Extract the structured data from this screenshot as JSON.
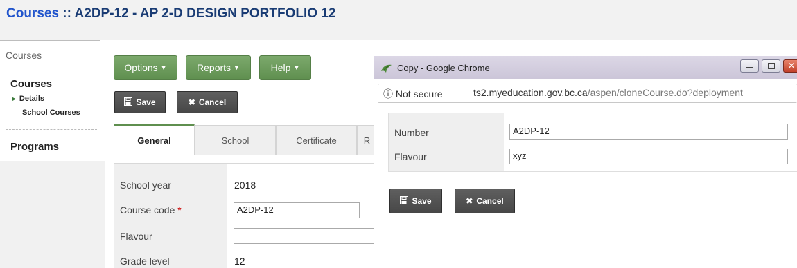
{
  "page": {
    "title_link": "Courses",
    "title_rest": " :: A2DP-12 - AP 2-D DESIGN PORTFOLIO 12"
  },
  "nav": {
    "header": "Courses",
    "section": "Courses",
    "items": [
      "Details",
      "School Courses"
    ],
    "programs": "Programs"
  },
  "menu": {
    "options": "Options",
    "reports": "Reports",
    "help": "Help"
  },
  "actions": {
    "save": "Save",
    "cancel": "Cancel"
  },
  "tabs": [
    "General",
    "School",
    "Certificate",
    "R"
  ],
  "form": {
    "school_year_label": "School year",
    "school_year_value": "2018",
    "course_code_label": "Course code",
    "course_code_required": "*",
    "course_code_value": "A2DP-12",
    "flavour_label": "Flavour",
    "flavour_value": "",
    "grade_level_label": "Grade level",
    "grade_level_value": "12"
  },
  "popup": {
    "window_title": "Copy - Google Chrome",
    "security_label": "Not secure",
    "url_domain": "ts2.myeducation.gov.bc.ca",
    "url_path": "/aspen/cloneCourse.do?deployment",
    "number_label": "Number",
    "number_value": "A2DP-12",
    "flavour_label": "Flavour",
    "flavour_value": "xyz",
    "save": "Save",
    "cancel": "Cancel"
  },
  "colors": {
    "accent_green": "#5f8f4f",
    "title_blue": "#1a3c74",
    "link_blue": "#2255cc",
    "required_red": "#cc0000"
  },
  "icons": [
    "save-icon",
    "cancel-icon",
    "caret-down-icon",
    "info-icon",
    "chrome-icon",
    "minimize-icon",
    "maximize-icon",
    "close-icon"
  ]
}
